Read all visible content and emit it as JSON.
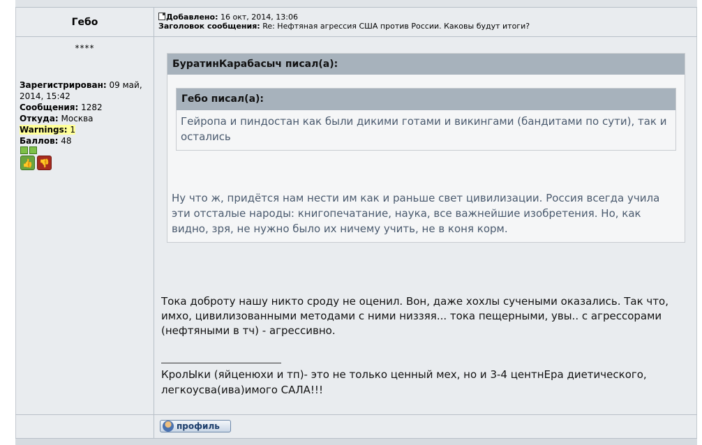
{
  "post": {
    "author": "Гебо",
    "added_label": "Добавлено:",
    "added_date": "16 окт, 2014, 13:06",
    "subject_label": "Заголовок сообщения:",
    "subject": "Re: Нефтяная агрессия США против России. Каковы будут итоги?"
  },
  "profile": {
    "rank_stars": "****",
    "registered_label": "Зарегистрирован:",
    "registered_value": "09 май, 2014, 15:42",
    "messages_label": "Сообщения:",
    "messages_value": "1282",
    "from_label": "Откуда:",
    "from_value": "Москва",
    "warnings_label": "Warnings:",
    "warnings_value": "1",
    "points_label": "Баллов:",
    "points_value": "48"
  },
  "quote_outer": {
    "header": "БуратинКарабасыч писал(а):",
    "text": "Ну что ж, придётся нам нести им как и раньше свет цивилизации. Россия всегда учила эти отсталые народы: книгопечатание, наука, все важнейшие изобретения. Но, как видно, зря, не нужно было их ничему учить, не в коня корм."
  },
  "quote_inner": {
    "header": "Гебо писал(а):",
    "text": "Гейропа и пиндостан как были дикими готами и викингами (бандитами по сути), так и остались"
  },
  "body_text": "Тока доброту нашу никто сроду не оценил. Вон, даже хохлы сучеными оказались. Так что, имхо, цивилизованными методами с ними низзяя... тока пещерными, увы.. с агрессорами (нефтяными в тч) - агрессивно.",
  "signature": "КролЫки (яйценюхи и тп)- это не только ценный мех, но и 3-4 центнЕра диетического, легкоусва(ива)имого САЛА!!!",
  "buttons": {
    "profile": "профиль"
  }
}
